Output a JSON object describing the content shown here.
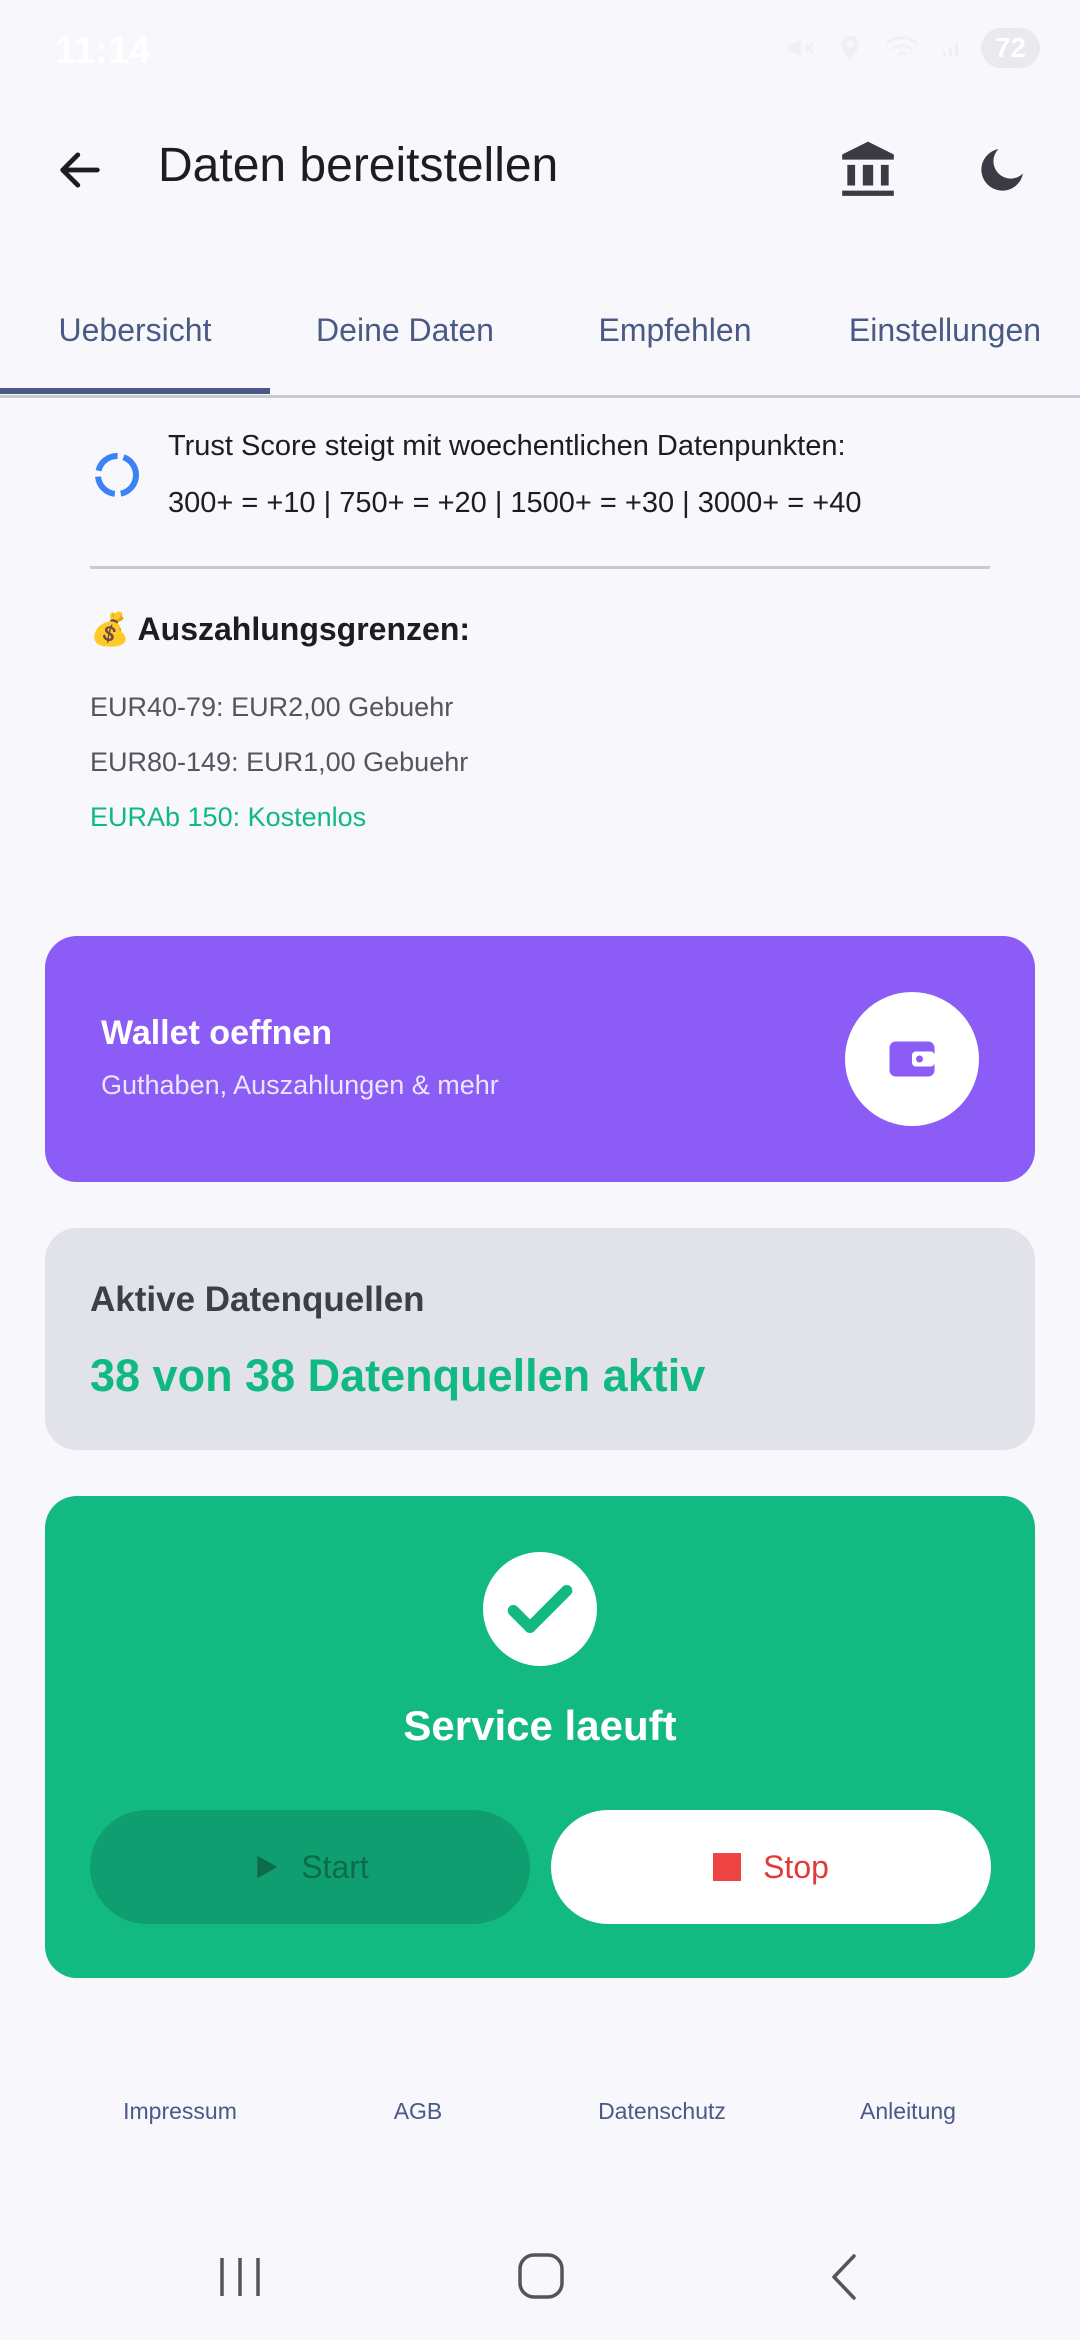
{
  "status": {
    "time": "11:14",
    "battery": "72"
  },
  "appbar": {
    "title": "Daten bereitstellen"
  },
  "tabs": [
    {
      "label": "Uebersicht"
    },
    {
      "label": "Deine Daten"
    },
    {
      "label": "Empfehlen"
    },
    {
      "label": "Einstellungen"
    }
  ],
  "trust": {
    "line1": "Trust Score steigt mit woechentlichen Datenpunkten:",
    "line2": "300+ = +10 | 750+ = +20 | 1500+ = +30 | 3000+ = +40"
  },
  "payout": {
    "heading": "💰 Auszahlungsgrenzen:",
    "limits": [
      "EUR40-79: EUR2,00 Gebuehr",
      "EUR80-149: EUR1,00 Gebuehr",
      "EURAb 150: Kostenlos"
    ]
  },
  "wallet": {
    "title": "Wallet oeffnen",
    "subtitle": "Guthaben, Auszahlungen & mehr"
  },
  "sources": {
    "title": "Aktive Datenquellen",
    "value": "38 von 38 Datenquellen aktiv"
  },
  "service": {
    "status": "Service laeuft",
    "start_label": "Start",
    "stop_label": "Stop"
  },
  "footer": {
    "links": [
      "Impressum",
      "AGB",
      "Datenschutz",
      "Anleitung"
    ]
  },
  "colors": {
    "accent": "#4a5a85",
    "wallet": "#8b5cf6",
    "success": "#12b981",
    "danger": "#ef4444"
  }
}
